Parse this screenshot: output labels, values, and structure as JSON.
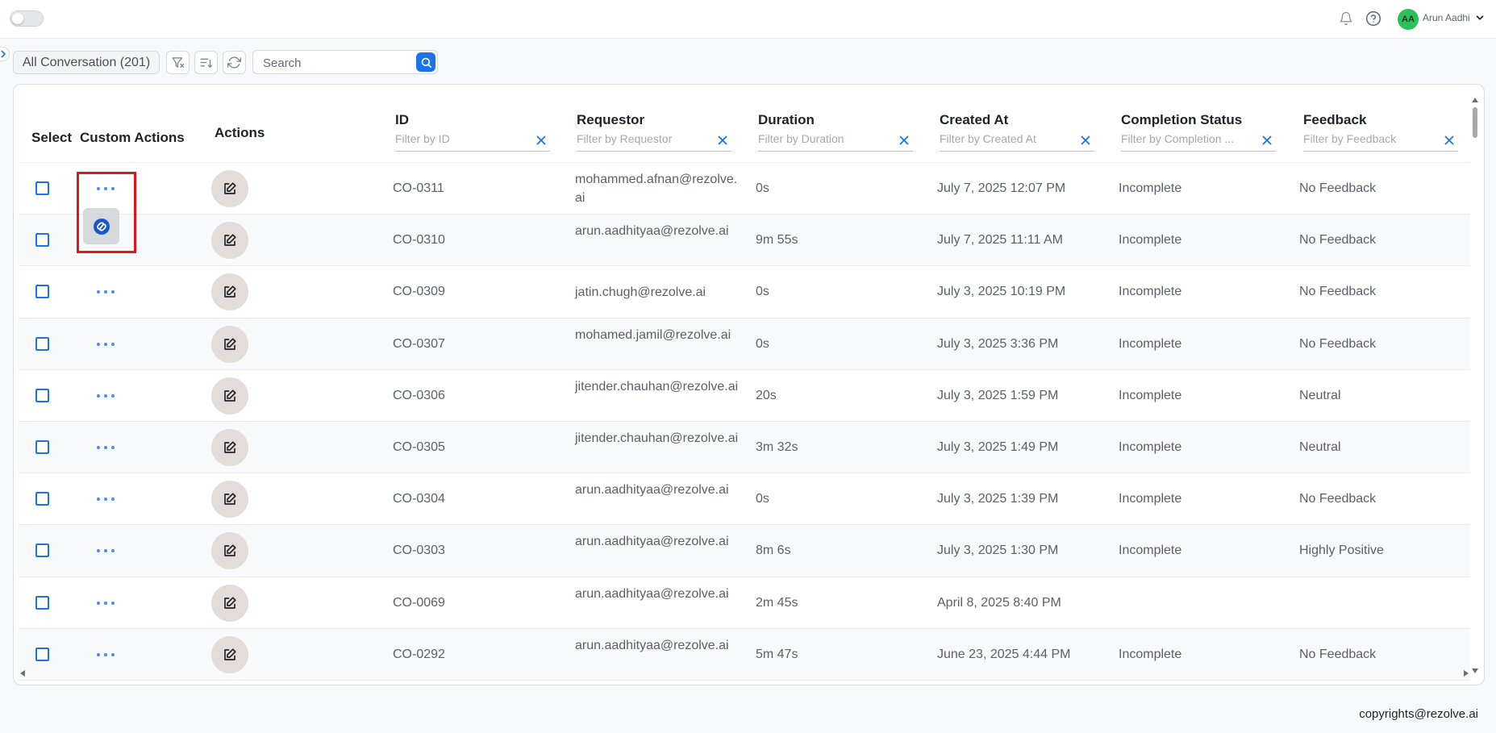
{
  "topbar": {
    "user_initials": "AA",
    "user_name": "Arun Aadhi",
    "icons": {
      "bell": "bell-icon",
      "help": "help-icon",
      "chevron": "chevron-down-icon"
    },
    "avatar_color": "#2bc15a"
  },
  "toolbar": {
    "conversation_label": "All Conversation (201)",
    "search_placeholder": "Search",
    "search_value": "",
    "icons": [
      "filter-icon",
      "sort-icon",
      "refresh-icon",
      "search-icon"
    ]
  },
  "table": {
    "headers": {
      "select": "Select",
      "custom_actions": "Custom Actions",
      "actions": "Actions",
      "id": "ID",
      "requestor": "Requestor",
      "duration": "Duration",
      "created_at": "Created At",
      "completion_status": "Completion Status",
      "feedback": "Feedback"
    },
    "filters": {
      "id": "Filter by ID",
      "requestor": "Filter by Requestor",
      "duration": "Filter by Duration",
      "created_at": "Filter by Created At",
      "completion_status": "Filter by Completion ...",
      "feedback": "Filter by Feedback"
    },
    "rows": [
      {
        "id": "CO-0311",
        "requestor": "mohammed.afnan@rezolve.ai",
        "duration": "0s",
        "created_at": "July 7, 2025 12:07 PM",
        "status": "Incomplete",
        "feedback": "No Feedback"
      },
      {
        "id": "CO-0310",
        "requestor": "arun.aadhityaa@rezolve.ai",
        "duration": "9m 55s",
        "created_at": "July 7, 2025 11:11 AM",
        "status": "Incomplete",
        "feedback": "No Feedback"
      },
      {
        "id": "CO-0309",
        "requestor": "jatin.chugh@rezolve.ai",
        "duration": "0s",
        "created_at": "July 3, 2025 10:19 PM",
        "status": "Incomplete",
        "feedback": "No Feedback"
      },
      {
        "id": "CO-0307",
        "requestor": "mohamed.jamil@rezolve.ai",
        "duration": "0s",
        "created_at": "July 3, 2025 3:36 PM",
        "status": "Incomplete",
        "feedback": "No Feedback"
      },
      {
        "id": "CO-0306",
        "requestor": "jitender.chauhan@rezolve.ai",
        "duration": "20s",
        "created_at": "July 3, 2025 1:59 PM",
        "status": "Incomplete",
        "feedback": "Neutral"
      },
      {
        "id": "CO-0305",
        "requestor": "jitender.chauhan@rezolve.ai",
        "duration": "3m 32s",
        "created_at": "July 3, 2025 1:49 PM",
        "status": "Incomplete",
        "feedback": "Neutral"
      },
      {
        "id": "CO-0304",
        "requestor": "arun.aadhityaa@rezolve.ai",
        "duration": "0s",
        "created_at": "July 3, 2025 1:39 PM",
        "status": "Incomplete",
        "feedback": "No Feedback"
      },
      {
        "id": "CO-0303",
        "requestor": "arun.aadhityaa@rezolve.ai",
        "duration": "8m 6s",
        "created_at": "July 3, 2025 1:30 PM",
        "status": "Incomplete",
        "feedback": "Highly Positive"
      },
      {
        "id": "CO-0069",
        "requestor": "arun.aadhityaa@rezolve.ai",
        "duration": "2m 45s",
        "created_at": "April 8, 2025 8:40 PM",
        "status": "",
        "feedback": ""
      },
      {
        "id": "CO-0292",
        "requestor": "arun.aadhityaa@rezolve.ai",
        "duration": "5m 47s",
        "created_at": "June 23, 2025 4:44 PM",
        "status": "Incomplete",
        "feedback": "No Feedback"
      }
    ]
  },
  "popup": {
    "icon": "link-sync-icon"
  },
  "colors": {
    "accent": "#1a73e8",
    "highlight": "#e0161c"
  },
  "footer": {
    "text": "copyrights@rezolve.ai"
  }
}
